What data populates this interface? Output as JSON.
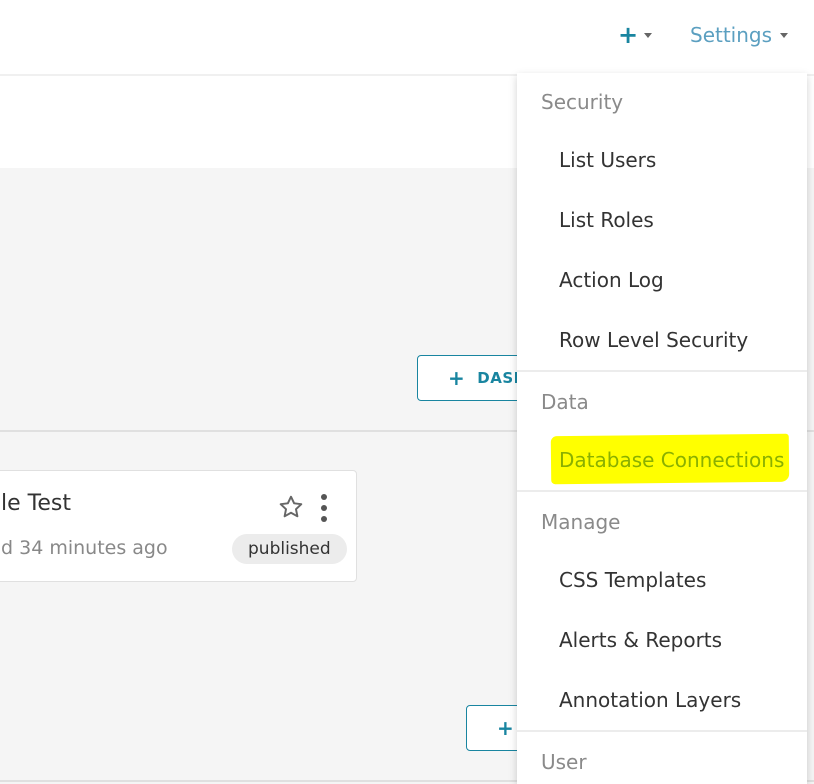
{
  "navbar": {
    "plus_glyph": "+",
    "settings_label": "Settings"
  },
  "content": {
    "dashboard_button_label": "DASH",
    "plus_glyph": "+",
    "card": {
      "title": "le Test",
      "meta": "d 34 minutes ago",
      "badge": "published"
    }
  },
  "menu": {
    "groups": [
      {
        "title": "Security",
        "items": [
          "List Users",
          "List Roles",
          "Action Log",
          "Row Level Security"
        ]
      },
      {
        "title": "Data",
        "items": [
          "Database Connections"
        ]
      },
      {
        "title": "Manage",
        "items": [
          "CSS Templates",
          "Alerts & Reports",
          "Annotation Layers"
        ]
      },
      {
        "title": "User",
        "items": []
      }
    ],
    "highlighted_item": "Database Connections"
  },
  "colors": {
    "primary": "#1985a0",
    "settings_text": "#5b9fc0",
    "highlight": "#ffff00",
    "highlighted_text": "#8ab000",
    "content_bg": "#f5f5f5"
  },
  "icons": [
    "plus-icon",
    "caret-down-icon",
    "star-icon",
    "kebab-menu-icon"
  ]
}
